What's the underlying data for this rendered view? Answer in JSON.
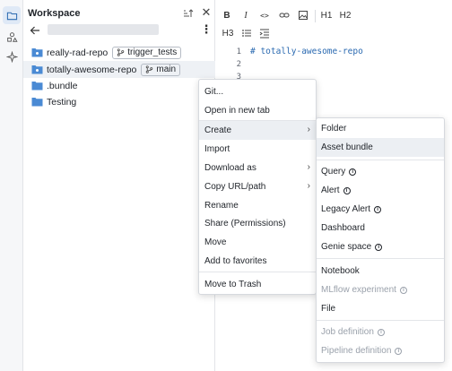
{
  "colors": {
    "folder": "#4a8ad4",
    "accent": "#2b6ab1",
    "rail_active": "#dfe9f6"
  },
  "rail": {
    "items": [
      "folder-icon",
      "shapes-icon",
      "sparkle-icon"
    ]
  },
  "workspace": {
    "title": "Workspace",
    "items": [
      {
        "label": "really-rad-repo",
        "icon": "repo-icon",
        "branch": "trigger_tests"
      },
      {
        "label": "totally-awesome-repo",
        "icon": "repo-icon",
        "branch": "main"
      },
      {
        "label": ".bundle",
        "icon": "folder-icon"
      },
      {
        "label": "Testing",
        "icon": "folder-icon"
      }
    ]
  },
  "editor": {
    "toolbar": [
      "B",
      "I",
      "<>",
      "link",
      "image",
      "H1",
      "H2",
      "H3",
      "list",
      "indent"
    ],
    "tb_labels": {
      "bold": "B",
      "italic": "I",
      "code": "<>",
      "h1": "H1",
      "h2": "H2",
      "h3": "H3"
    },
    "lines": [
      {
        "no": "1",
        "text": "# totally-awesome-repo"
      },
      {
        "no": "2",
        "text": ""
      },
      {
        "no": "3",
        "text": ""
      }
    ]
  },
  "context_menu": {
    "items": [
      {
        "label": "Git..."
      },
      {
        "label": "Open in new tab"
      },
      {
        "label": "Create",
        "submenu": true
      },
      {
        "label": "Import"
      },
      {
        "label": "Download as",
        "submenu": true
      },
      {
        "label": "Copy URL/path",
        "submenu": true
      },
      {
        "label": "Rename"
      },
      {
        "label": "Share (Permissions)"
      },
      {
        "label": "Move"
      },
      {
        "label": "Add to favorites"
      },
      {
        "label": "Move to Trash"
      }
    ]
  },
  "create_submenu": {
    "items": [
      {
        "label": "Folder"
      },
      {
        "label": "Asset bundle"
      },
      {
        "label": "Query"
      },
      {
        "label": "Alert"
      },
      {
        "label": "Legacy Alert"
      },
      {
        "label": "Dashboard"
      },
      {
        "label": "Genie space"
      },
      {
        "label": "Notebook"
      },
      {
        "label": "MLflow experiment"
      },
      {
        "label": "File"
      },
      {
        "label": "Job definition"
      },
      {
        "label": "Pipeline definition"
      }
    ],
    "info_glyph": "i"
  }
}
